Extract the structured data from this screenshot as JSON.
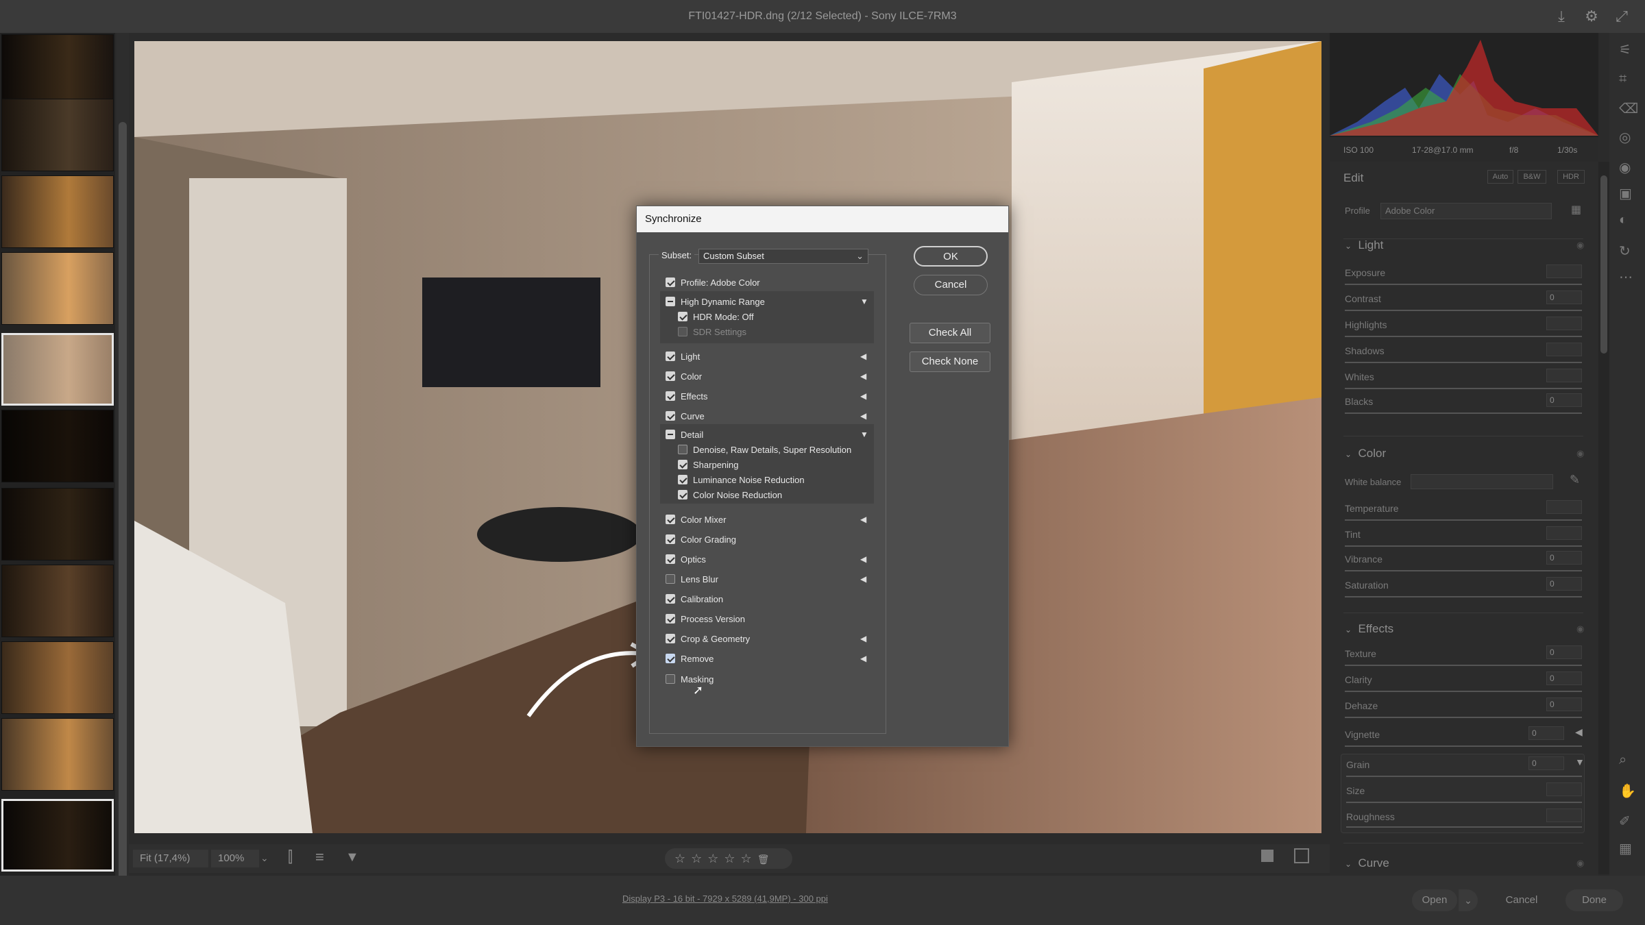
{
  "window": {
    "title": "FTI01427-HDR.dng (2/12 Selected)  -  Sony ILCE-7RM3"
  },
  "toolbar_icons": [
    "download-icon",
    "gear-icon",
    "expand-icon"
  ],
  "canvas_bar": {
    "zoom_fit": "Fit (17,4%)",
    "zoom_100": "100%",
    "stars": 5
  },
  "status": {
    "info": "Display P3 - 16 bit - 7929 x 5289 (41,9MP) - 300 ppi",
    "open": "Open",
    "cancel": "Cancel",
    "done": "Done"
  },
  "meta": {
    "iso": "ISO 100",
    "lens": "17-28@17.0 mm",
    "aperture": "f/8",
    "shutter": "1/30s"
  },
  "edit": {
    "title": "Edit",
    "buttons": [
      "Auto",
      "B&W",
      "HDR"
    ],
    "profile_label": "Profile",
    "profile_value": "Adobe Color",
    "light": {
      "title": "Light",
      "exposure": "Exposure",
      "contrast": "Contrast",
      "contrast_val": "0",
      "highlights": "Highlights",
      "shadows": "Shadows",
      "whites": "Whites",
      "blacks": "Blacks",
      "blacks_val": "0"
    },
    "color": {
      "title": "Color",
      "white_balance": "White balance",
      "temperature": "Temperature",
      "tint": "Tint",
      "vibrance": "Vibrance",
      "vibrance_val": "0",
      "saturation": "Saturation",
      "saturation_val": "0"
    },
    "effects": {
      "title": "Effects",
      "texture": "Texture",
      "texture_val": "0",
      "clarity": "Clarity",
      "clarity_val": "0",
      "dehaze": "Dehaze",
      "dehaze_val": "0",
      "vignette": "Vignette",
      "vignette_val": "0",
      "grain": "Grain",
      "grain_val": "0",
      "size": "Size",
      "roughness": "Roughness"
    },
    "curve": {
      "title": "Curve"
    }
  },
  "dialog": {
    "title": "Synchronize",
    "subset_label": "Subset:",
    "subset_value": "Custom Subset",
    "ok": "OK",
    "cancel": "Cancel",
    "check_all": "Check All",
    "check_none": "Check None",
    "items": {
      "profile": "Profile: Adobe Color",
      "hdr": "High Dynamic Range",
      "hdr_mode": "HDR Mode: Off",
      "sdr": "SDR Settings",
      "light": "Light",
      "color": "Color",
      "effects": "Effects",
      "curve": "Curve",
      "detail": "Detail",
      "denoise": "Denoise, Raw Details, Super Resolution",
      "sharpening": "Sharpening",
      "luminance": "Luminance Noise Reduction",
      "color_noise": "Color Noise Reduction",
      "color_mixer": "Color Mixer",
      "color_grading": "Color Grading",
      "optics": "Optics",
      "lens_blur": "Lens Blur",
      "calibration": "Calibration",
      "process": "Process Version",
      "crop": "Crop & Geometry",
      "remove": "Remove",
      "masking": "Masking"
    }
  }
}
